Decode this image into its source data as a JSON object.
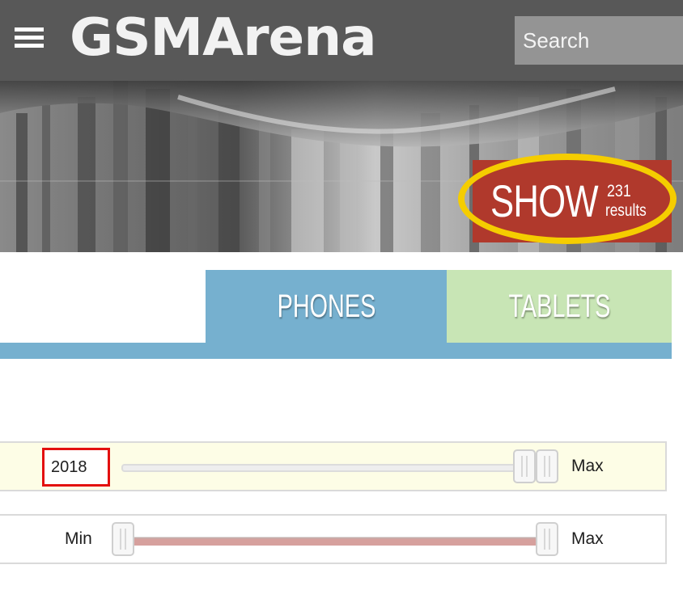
{
  "header": {
    "menu_icon": "hamburger-menu-icon",
    "logo_text": "GSMArena",
    "search_placeholder": "Search"
  },
  "show_button": {
    "label": "SHOW",
    "count": "231",
    "unit": "results"
  },
  "tabs": [
    {
      "label": "PHONES"
    },
    {
      "label": "TABLETS"
    }
  ],
  "filters": {
    "year": {
      "value": "2018",
      "max_label": "Max"
    },
    "second": {
      "min_label": "Min",
      "max_label": "Max"
    }
  },
  "colors": {
    "header_bg": "#585858",
    "show_button_bg": "#b0392c",
    "highlight_ellipse": "#f5cd00",
    "tab_phones": "#76b0cf",
    "tab_tablets": "#c8e5b5",
    "value_box_highlight": "#e3100f",
    "year_row_bg": "#fdfde6"
  }
}
